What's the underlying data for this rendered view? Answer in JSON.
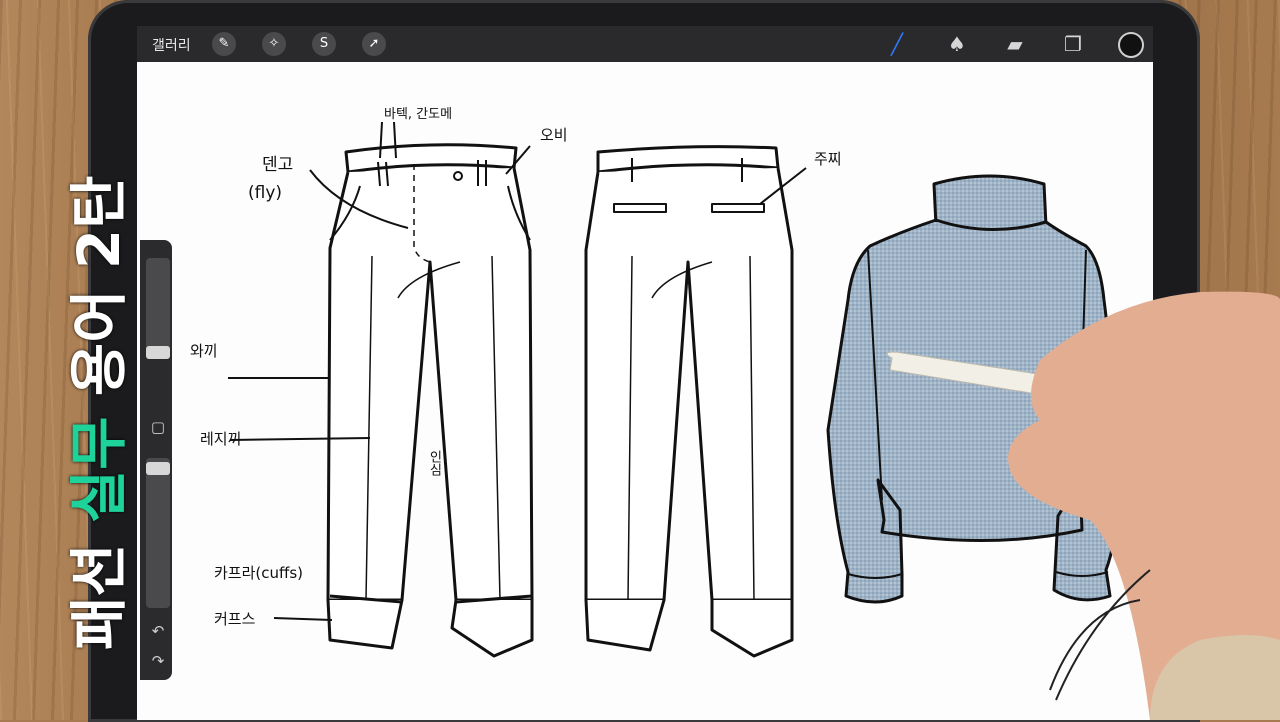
{
  "title_overlay": {
    "part1": "패션",
    "accent": "실무",
    "part2": "용어 2탄"
  },
  "toolbar": {
    "gallery": "갤러리",
    "icons": [
      "wrench-icon",
      "magic-wand-icon",
      "selection-icon",
      "arrow-icon"
    ],
    "right_icons": [
      "brush-icon",
      "smudge-icon",
      "eraser-icon",
      "layers-icon"
    ]
  },
  "labels": {
    "fly": "덴고",
    "fly_en": "(fly)",
    "beltloop": "바텍, 간도메",
    "waistband": "오비",
    "pocket": "주찌",
    "outseam": "와끼",
    "pleat": "레지끼",
    "inseam": "인심",
    "cuff1": "카프라(cuffs)",
    "cuff2": "커프스"
  },
  "colors": {
    "accent": "#1dd39a",
    "sweater": "#9eb2c6",
    "pen": "#f2efe6"
  }
}
